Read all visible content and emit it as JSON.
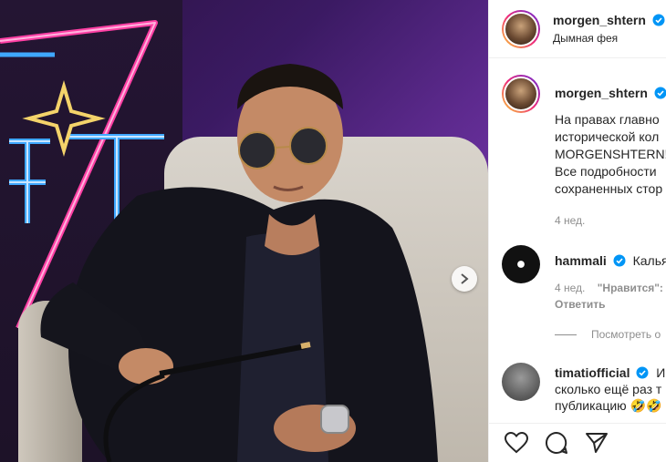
{
  "post": {
    "image_alt": "post-photo",
    "next_icon": "chevron-right-icon"
  },
  "header": {
    "username": "morgen_shtern",
    "location": "Дымная фея",
    "verified_icon": "verified-badge-icon"
  },
  "caption": {
    "username": "morgen_shtern",
    "lines": [
      "На правах главно",
      "исторической кол",
      "MORGENSHTERN!",
      "Все подробности",
      "сохраненных стор"
    ],
    "time": "4 нед."
  },
  "comments": [
    {
      "username": "hammali",
      "text": "Кальян",
      "time": "4 нед.",
      "likes": "\"Нравится\":",
      "reply_label": "Ответить"
    },
    {
      "username": "timatiofficial",
      "text_first": "Ин",
      "text_lines": [
        "сколько ещё раз т",
        "публикацию 🤣🤣"
      ]
    }
  ],
  "view_replies": "Посмотреть о",
  "colors": {
    "verified": "#0095f6",
    "text": "#262626",
    "secondary": "#8e8e8e"
  }
}
